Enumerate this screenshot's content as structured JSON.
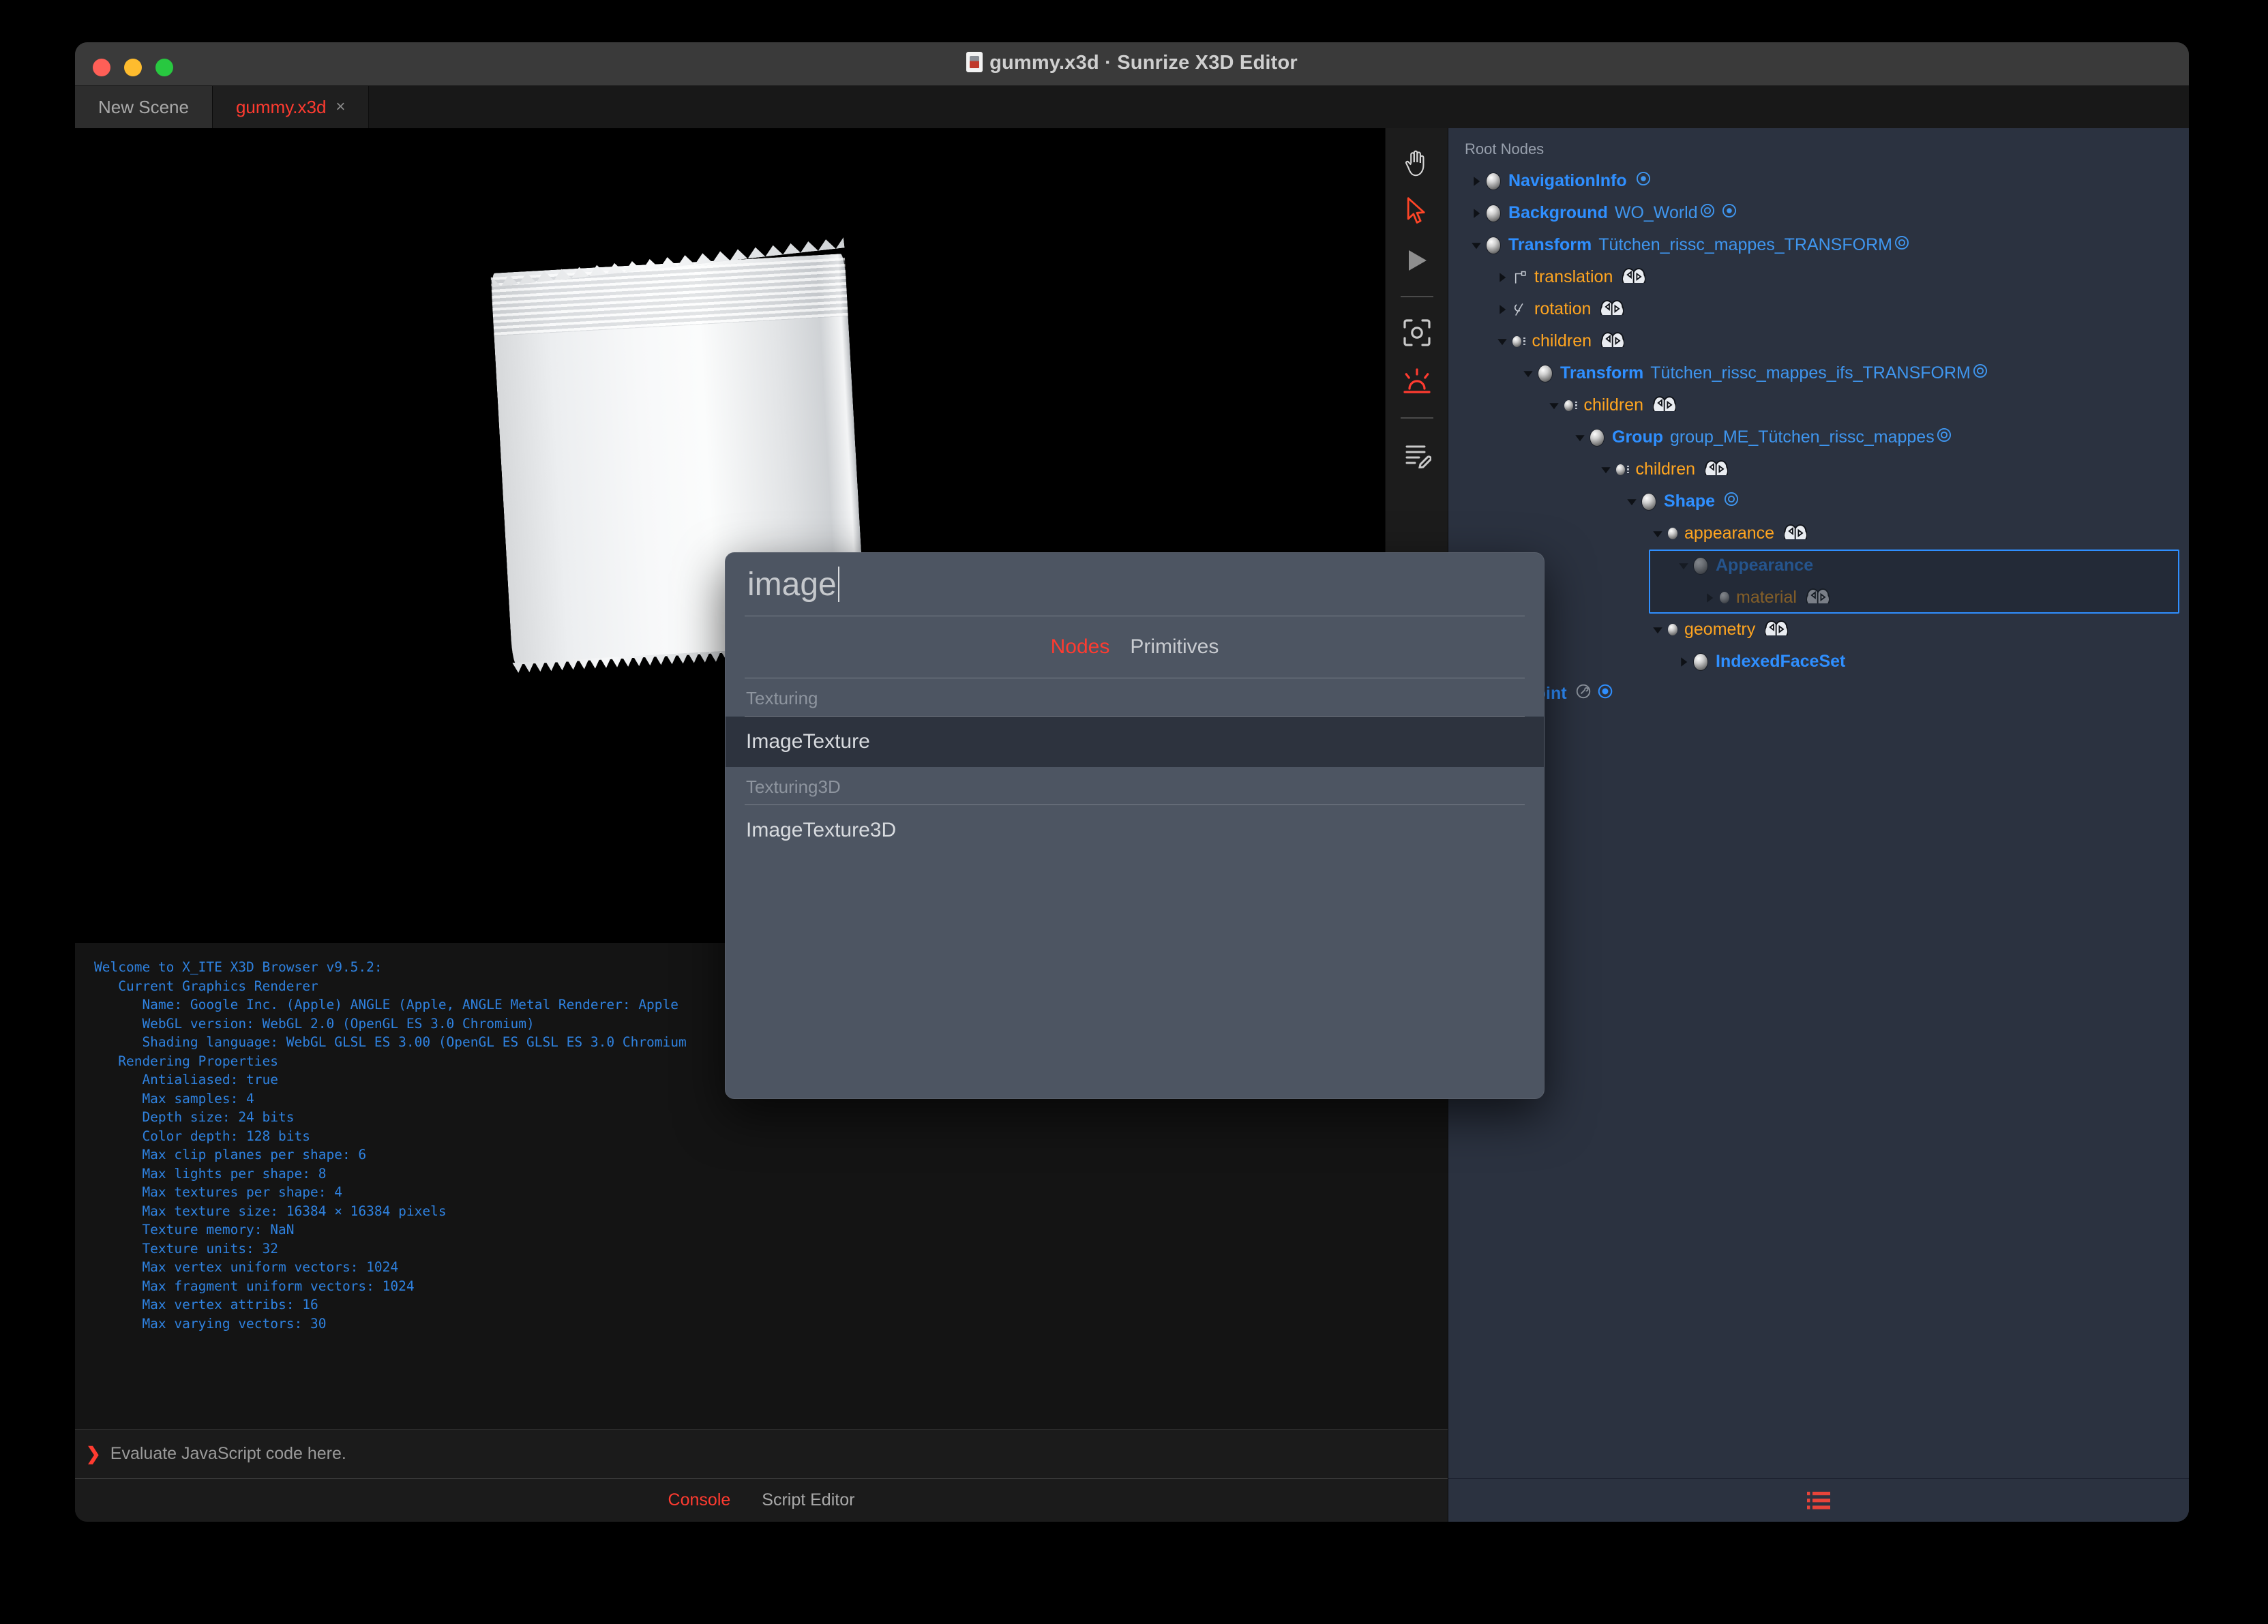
{
  "window": {
    "title": "gummy.x3d · Sunrize X3D Editor",
    "title_icon": "x3d-file-icon",
    "controls": {
      "close": "close",
      "minimize": "minimize",
      "maximize": "maximize"
    }
  },
  "tabs": [
    {
      "label": "New Scene",
      "active": false,
      "closable": false
    },
    {
      "label": "gummy.x3d",
      "active": true,
      "closable": true,
      "close_glyph": "×"
    }
  ],
  "toolbar": {
    "items": [
      {
        "name": "hand-tool",
        "icon": "hand-icon",
        "active": false
      },
      {
        "name": "select-tool",
        "icon": "arrow-cursor-icon",
        "active": true
      },
      {
        "name": "play-tool",
        "icon": "play-icon",
        "active": false
      },
      {
        "name": "separator-1",
        "icon": "divider",
        "active": false
      },
      {
        "name": "viewpoint-tool",
        "icon": "camera-frame-icon",
        "active": false
      },
      {
        "name": "lighting-tool",
        "icon": "sunrise-icon",
        "active": true
      },
      {
        "name": "separator-2",
        "icon": "divider",
        "active": false
      },
      {
        "name": "edit-tool",
        "icon": "lines-pencil-icon",
        "active": false
      }
    ]
  },
  "viewport": {
    "object": "gummy-package-3d-model",
    "background": "#000000"
  },
  "console": {
    "output": "Welcome to X_ITE X3D Browser v9.5.2:\n   Current Graphics Renderer\n      Name: Google Inc. (Apple) ANGLE (Apple, ANGLE Metal Renderer: Apple\n      WebGL version: WebGL 2.0 (OpenGL ES 3.0 Chromium)\n      Shading language: WebGL GLSL ES 3.00 (OpenGL ES GLSL ES 3.0 Chromium\n   Rendering Properties\n      Antialiased: true\n      Max samples: 4\n      Depth size: 24 bits\n      Color depth: 128 bits\n      Max clip planes per shape: 6\n      Max lights per shape: 8\n      Max textures per shape: 4\n      Max texture size: 16384 × 16384 pixels\n      Texture memory: NaN\n      Texture units: 32\n      Max vertex uniform vectors: 1024\n      Max fragment uniform vectors: 1024\n      Max vertex attribs: 16\n      Max varying vectors: 30",
    "prompt_glyph": "❯",
    "input_placeholder": "Evaluate JavaScript code here."
  },
  "footer_tabs": [
    {
      "label": "Console",
      "active": true
    },
    {
      "label": "Script Editor",
      "active": false
    }
  ],
  "outline": {
    "header": "Root Nodes",
    "footer_icon": "list-icon",
    "rows": [
      {
        "indent": 0,
        "twisty": "collapsed",
        "icon": "node-sphere",
        "type": "NavigationInfo",
        "name": "",
        "field": "",
        "icons": [
          "target-icon"
        ]
      },
      {
        "indent": 0,
        "twisty": "collapsed",
        "icon": "node-sphere",
        "type": "Background",
        "name": "WO_World",
        "field": "",
        "icons": [
          "circle-ring-icon",
          "target-icon"
        ]
      },
      {
        "indent": 0,
        "twisty": "expanded",
        "icon": "node-sphere",
        "type": "Transform",
        "name": "Tütchen_rissc_mappes_TRANSFORM",
        "field": "",
        "icons": [
          "circle-ring-icon"
        ]
      },
      {
        "indent": 1,
        "twisty": "collapsed",
        "icon": "sfvec3f-icon",
        "type": "",
        "name": "",
        "field": "translation",
        "icons": [
          "route-io-icon"
        ]
      },
      {
        "indent": 1,
        "twisty": "collapsed",
        "icon": "sfrotation-icon",
        "type": "",
        "name": "",
        "field": "rotation",
        "icons": [
          "route-io-icon"
        ]
      },
      {
        "indent": 1,
        "twisty": "expanded",
        "icon": "mfnode-icon",
        "type": "",
        "name": "",
        "field": "children",
        "icons": [
          "route-io-icon"
        ]
      },
      {
        "indent": 2,
        "twisty": "expanded",
        "icon": "node-sphere",
        "type": "Transform",
        "name": "Tütchen_rissc_mappes_ifs_TRANSFORM",
        "field": "",
        "icons": [
          "circle-ring-icon"
        ]
      },
      {
        "indent": 3,
        "twisty": "expanded",
        "icon": "mfnode-icon",
        "type": "",
        "name": "",
        "field": "children",
        "icons": [
          "route-io-icon"
        ]
      },
      {
        "indent": 4,
        "twisty": "expanded",
        "icon": "node-sphere",
        "type": "Group",
        "name": "group_ME_Tütchen_rissc_mappes",
        "field": "",
        "icons": [
          "circle-ring-icon"
        ]
      },
      {
        "indent": 5,
        "twisty": "expanded",
        "icon": "mfnode-icon",
        "type": "",
        "name": "",
        "field": "children",
        "icons": [
          "route-io-icon"
        ]
      },
      {
        "indent": 6,
        "twisty": "expanded",
        "icon": "node-sphere",
        "type": "Shape",
        "name": "",
        "field": "",
        "icons": [
          "circle-ring-icon"
        ]
      },
      {
        "indent": 7,
        "twisty": "expanded",
        "icon": "sfnode-icon",
        "type": "",
        "name": "",
        "field": "appearance",
        "icons": [
          "route-io-icon"
        ]
      },
      {
        "indent": 8,
        "twisty": "expanded",
        "icon": "node-sphere",
        "type": "Appearance",
        "name": "",
        "field": "",
        "icons": [],
        "selected": true
      },
      {
        "indent": 9,
        "twisty": "collapsed",
        "icon": "sfnode-icon",
        "type": "",
        "name": "",
        "field": "material",
        "icons": [
          "route-io-icon"
        ],
        "selected": true
      },
      {
        "indent": 7,
        "twisty": "expanded",
        "icon": "sfnode-icon",
        "type": "",
        "name": "",
        "field": "geometry",
        "icons": [
          "route-io-icon"
        ]
      },
      {
        "indent": 8,
        "twisty": "collapsed",
        "icon": "node-sphere",
        "type": "IndexedFaceSet",
        "name": "",
        "field": "",
        "icons": []
      },
      {
        "indent": 0,
        "twisty": "none",
        "icon": "",
        "type": "Viewpoint",
        "name": "",
        "field": "",
        "icons": [
          "wrench-icon",
          "radio-on-icon"
        ],
        "occluded": true
      }
    ]
  },
  "dialog": {
    "query": "image",
    "tabs": [
      {
        "label": "Nodes",
        "active": true
      },
      {
        "label": "Primitives",
        "active": false
      }
    ],
    "groups": [
      {
        "title": "Texturing",
        "items": [
          {
            "label": "ImageTexture",
            "highlighted": true
          }
        ]
      },
      {
        "title": "Texturing3D",
        "items": [
          {
            "label": "ImageTexture3D",
            "highlighted": false
          }
        ]
      }
    ]
  },
  "colors": {
    "accent_red": "#ff3b30",
    "node_blue": "#2f8fff",
    "field_orange": "#ffa520",
    "console_blue": "#2f82e0",
    "panel_bg": "#2b3240",
    "dialog_bg": "#4d5562"
  }
}
